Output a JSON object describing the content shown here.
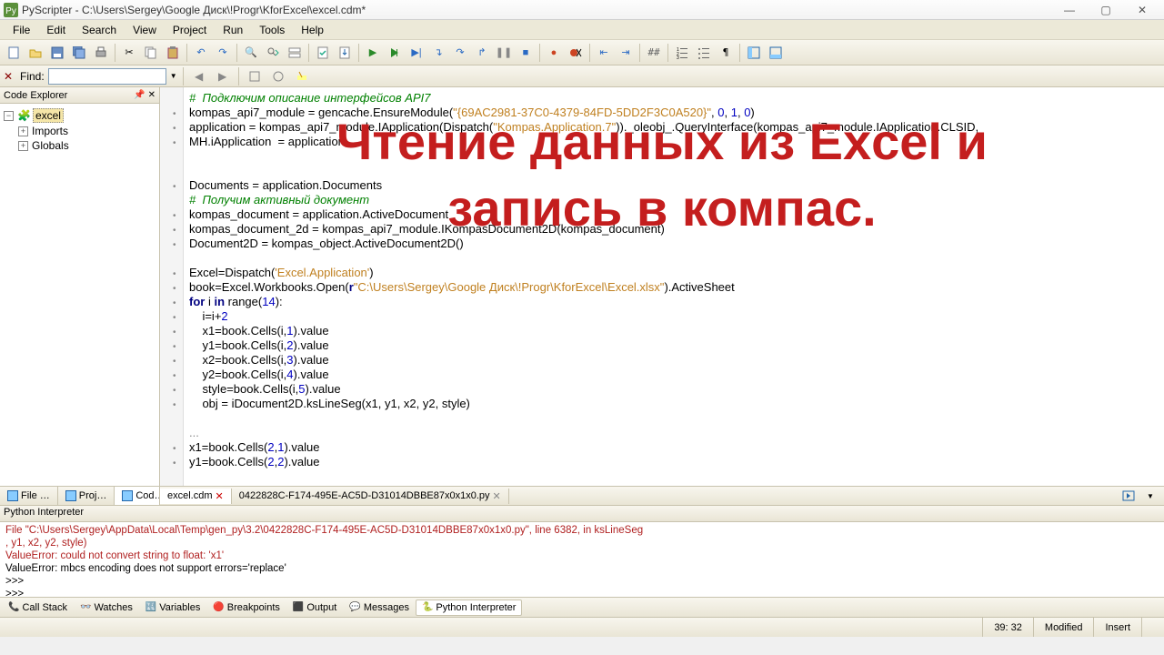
{
  "window": {
    "title": "PyScripter - C:\\Users\\Sergey\\Google Диск\\!Progr\\KforExcel\\excel.cdm*"
  },
  "menu": [
    "File",
    "Edit",
    "Search",
    "View",
    "Project",
    "Run",
    "Tools",
    "Help"
  ],
  "find": {
    "label": "Find:",
    "value": ""
  },
  "sidebar": {
    "title": "Code Explorer",
    "root": "excel",
    "children": [
      "Imports",
      "Globals"
    ]
  },
  "code_lines": [
    {
      "dot": false,
      "cls": "c-comment",
      "t": "#  Подключим описание интерфейсов API7"
    },
    {
      "dot": true,
      "t": "kompas_api7_module = gencache.EnsureModule(\"{69AC2981-37C0-4379-84FD-5DD2F3C0A520}\", 0, 1, 0)",
      "html": "kompas_api7_module = gencache.EnsureModule(<span class='c-str'>\"{69AC2981-37C0-4379-84FD-5DD2F3C0A520}\"</span>, <span class='c-num'>0</span>, <span class='c-num'>1</span>, <span class='c-num'>0</span>)"
    },
    {
      "dot": true,
      "html": "application = kompas_api7_module.IApplication(Dispatch(<span class='c-str'>\"Kompas.Application.7\"</span>))._oleobj_.QueryInterface(kompas_api7_module.IApplication.CLSID,"
    },
    {
      "dot": true,
      "t": "MH.iApplication  = application"
    },
    {
      "dot": false,
      "t": " "
    },
    {
      "dot": false,
      "t": " "
    },
    {
      "dot": true,
      "t": "Documents = application.Documents"
    },
    {
      "dot": false,
      "cls": "c-comment",
      "t": "#  Получим активный документ"
    },
    {
      "dot": true,
      "t": "kompas_document = application.ActiveDocument"
    },
    {
      "dot": true,
      "t": "kompas_document_2d = kompas_api7_module.IKompasDocument2D(kompas_document)"
    },
    {
      "dot": true,
      "t": "Document2D = kompas_object.ActiveDocument2D()"
    },
    {
      "dot": false,
      "t": " "
    },
    {
      "dot": true,
      "html": "Excel=Dispatch(<span class='c-str'>'Excel.Application'</span>)"
    },
    {
      "dot": true,
      "html": "book=Excel.Workbooks.Open(<span class='c-kw'>r</span><span class='c-str'>\"C:\\Users\\Sergey\\Google Диск\\!Progr\\KforExcel\\Excel.xlsx\"</span>).ActiveSheet"
    },
    {
      "dot": true,
      "html": "<span class='c-kw'>for</span> i <span class='c-kw'>in</span> range(<span class='c-num'>14</span>):"
    },
    {
      "dot": true,
      "html": "    i=i+<span class='c-num'>2</span>"
    },
    {
      "dot": true,
      "html": "    x1=book.Cells(i,<span class='c-num'>1</span>).value"
    },
    {
      "dot": true,
      "html": "    y1=book.Cells(i,<span class='c-num'>2</span>).value"
    },
    {
      "dot": true,
      "html": "    x2=book.Cells(i,<span class='c-num'>3</span>).value"
    },
    {
      "dot": true,
      "html": "    y2=book.Cells(i,<span class='c-num'>4</span>).value"
    },
    {
      "dot": true,
      "html": "    style=book.Cells(i,<span class='c-num'>5</span>).value"
    },
    {
      "dot": true,
      "t": "    obj = iDocument2D.ksLineSeg(x1, y1, x2, y2, style)"
    },
    {
      "dot": false,
      "t": " "
    },
    {
      "dot": false,
      "cls": "c-gray",
      "t": "..."
    },
    {
      "dot": true,
      "html": "x1=book.Cells(<span class='c-num'>2</span>,<span class='c-num'>1</span>).value"
    },
    {
      "dot": true,
      "html": "y1=book.Cells(<span class='c-num'>2</span>,<span class='c-num'>2</span>).value"
    }
  ],
  "overlay": {
    "line1": "Чтение данных из Excel и",
    "line2": "запись в компас."
  },
  "left_tabs": [
    "File …",
    "Proj…",
    "Cod…"
  ],
  "editor_tabs": [
    "excel.cdm",
    "0422828C-F174-495E-AC5D-D31014DBBE87x0x1x0.py"
  ],
  "interpreter": {
    "title": "Python Interpreter",
    "lines": [
      {
        "err": true,
        "t": "  File \"C:\\Users\\Sergey\\AppData\\Local\\Temp\\gen_py\\3.2\\0422828C-F174-495E-AC5D-D31014DBBE87x0x1x0.py\", line 6382, in ksLineSeg"
      },
      {
        "err": true,
        "t": "    , y1, x2, y2, style)"
      },
      {
        "err": true,
        "t": "ValueError: could not convert string to float: 'x1'"
      },
      {
        "err": false,
        "t": "ValueError: mbcs encoding does not support errors='replace'"
      },
      {
        "err": false,
        "t": ">>> "
      },
      {
        "err": false,
        "t": ">>> "
      }
    ]
  },
  "bottom_tabs": [
    "Call Stack",
    "Watches",
    "Variables",
    "Breakpoints",
    "Output",
    "Messages",
    "Python Interpreter"
  ],
  "status": {
    "pos": "39: 32",
    "mod": "Modified",
    "ins": "Insert"
  }
}
